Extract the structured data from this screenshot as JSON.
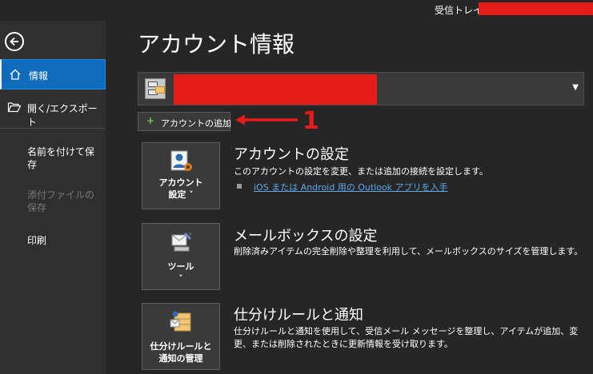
{
  "window": {
    "inbox_title": "受信トレイ -"
  },
  "sidebar": {
    "items": [
      {
        "label": "情報"
      },
      {
        "label": "開く/エクスポート"
      },
      {
        "label": "名前を付けて保存"
      },
      {
        "label": "添付ファイルの保存"
      },
      {
        "label": "印刷"
      }
    ]
  },
  "main": {
    "page_title": "アカウント情報",
    "add_account_label": "アカウントの追加",
    "annotation_number": "1",
    "sections": [
      {
        "tile_label_1": "アカウント",
        "tile_label_2": "設定 ˅",
        "title": "アカウントの設定",
        "desc": "このアカウントの設定を変更、または追加の接続を設定します。",
        "link": "iOS または Android 用の Outlook アプリを入手"
      },
      {
        "tile_label_1": "ツール",
        "tile_label_2": "˅",
        "title": "メールボックスの設定",
        "desc": "削除済みアイテムの完全削除や整理を利用して、メールボックスのサイズを管理します。"
      },
      {
        "tile_label_1": "仕分けルールと",
        "tile_label_2": "通知の管理",
        "title": "仕分けルールと通知",
        "desc": "仕分けルールと通知を使用して、受信メール メッセージを整理し、アイテムが追加、変更、または削除されたときに更新情報を受け取ります。"
      }
    ]
  },
  "colors": {
    "accent": "#0f6cbd",
    "redaction": "#e81b1b",
    "link": "#5ea9ec"
  }
}
